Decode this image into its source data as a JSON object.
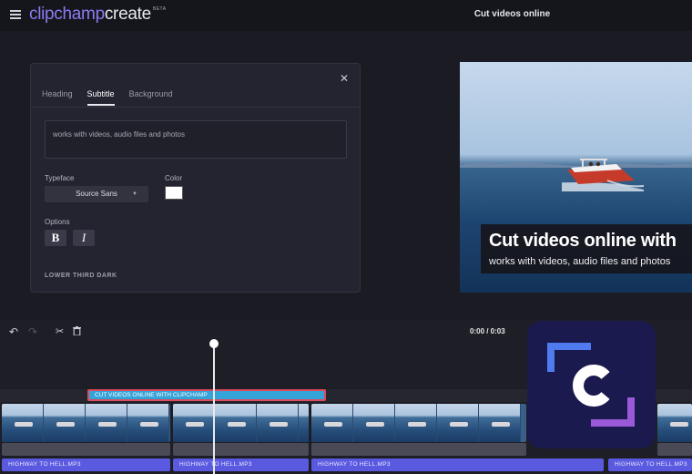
{
  "app": {
    "logo_part1": "clipchamp",
    "logo_part2": "create",
    "logo_tag": "BETA",
    "page_title": "Cut videos online"
  },
  "panel": {
    "tabs": [
      {
        "label": "Heading",
        "active": false
      },
      {
        "label": "Subtitle",
        "active": true
      },
      {
        "label": "Background",
        "active": false
      }
    ],
    "text_value": "works with videos, audio files and photos",
    "typeface_label": "Typeface",
    "typeface_value": "Source Sans",
    "color_label": "Color",
    "color_value": "#ffffff",
    "options_label": "Options",
    "bold_label": "B",
    "italic_label": "I",
    "preset_label": "LOWER THIRD DARK"
  },
  "preview": {
    "title": "Cut videos online with",
    "subtitle": "works with videos, audio files and photos"
  },
  "timeline": {
    "timecode": "0:00 / 0:03",
    "text_clip_label": "CUT VIDEOS ONLINE WITH CLIPCHAMP",
    "audio_clips": [
      "HIGHWAY TO HELL.MP3",
      "HIGHWAY TO HELL.MP3",
      "HIGHWAY TO HELL.MP3",
      "HIGHWAY TO HELL.MP3"
    ]
  },
  "colors": {
    "accent": "#8a7cf0",
    "text_clip": "#34a3d8",
    "text_clip_border": "#e04a5a",
    "audio_clip": "#5a5ae0",
    "badge_bg": "#1b1a4f"
  }
}
